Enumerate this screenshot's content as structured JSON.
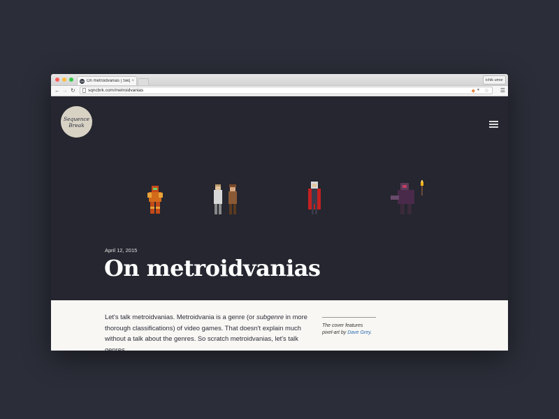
{
  "browser": {
    "tab_title": "On metroidvanias | Sequence Break",
    "tab_close": "×",
    "user_name": "ichik umor",
    "url": "sqncbrk.com/metroidvanias",
    "back_icon": "back-arrow-icon",
    "forward_icon": "forward-arrow-icon",
    "reload_icon": "reload-icon",
    "star_icon": "star-icon",
    "menu_icon": "hamburger-menu-icon"
  },
  "site": {
    "logo_line1": "Sequence",
    "logo_line2": "Break",
    "nav_icon": "hamburger-menu-icon"
  },
  "post": {
    "date": "April 12, 2015",
    "title": "On metroidvanias",
    "body_prefix": "Let's talk metroidvanias. Metroidvania is a genre (or ",
    "body_em": "subgenre",
    "body_suffix": " in more thorough classifications) of video games. That doesn't explain much without a talk about the genres. So scratch metroidvanias, let's talk genres.",
    "caption_text": "The cover features pixel-art by ",
    "caption_link": "Dave Grey",
    "caption_end": "."
  },
  "colors": {
    "page_bg": "#25262f",
    "content_bg": "#f8f7f4",
    "logo_bg": "#d8d2c5",
    "link": "#2a6cb0"
  }
}
